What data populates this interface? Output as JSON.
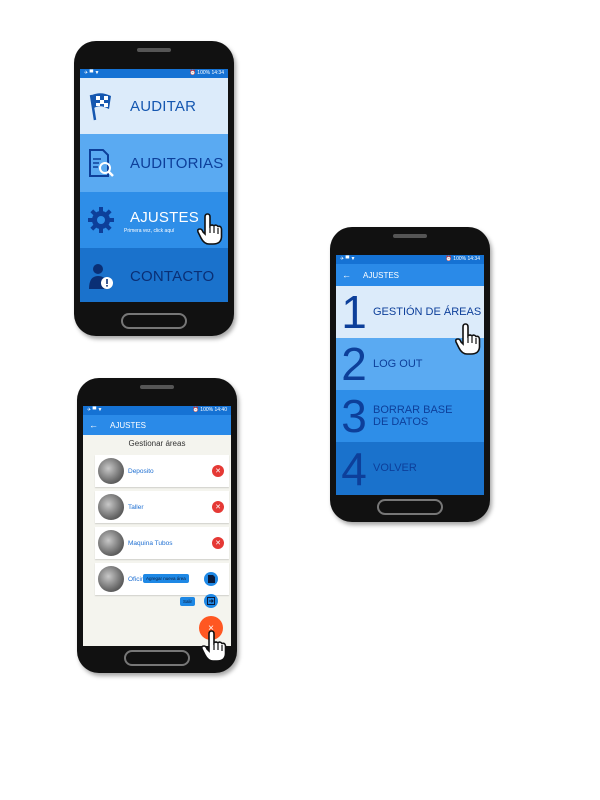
{
  "phone1": {
    "status": {
      "left": "✈ ▀ ▼",
      "right": "⏰ 100% 14:34"
    },
    "menu": [
      {
        "label": "AUDITAR",
        "icon": "checkered-flag-icon",
        "bg": "#dcebfa"
      },
      {
        "label": "AUDITORIAS",
        "icon": "document-search-icon",
        "bg": "#5aaaf2"
      },
      {
        "label": "AJUSTES",
        "icon": "gear-icon",
        "bg": "#2e8ee8",
        "sub": "Primera vez, click aquí"
      },
      {
        "label": "CONTACTO",
        "icon": "user-info-icon",
        "bg": "#1a72cc"
      }
    ]
  },
  "phone2": {
    "status": {
      "left": "✈ ▀ ▼",
      "right": "⏰ 100% 14:34"
    },
    "title": "AJUSTES",
    "items": [
      {
        "digit": "1",
        "label": "GESTIÓN DE ÁREAS",
        "bg": "#dcebfa"
      },
      {
        "digit": "2",
        "label": "LOG OUT",
        "bg": "#5aaaf2"
      },
      {
        "digit": "3",
        "label": "BORRAR BASE DE DATOS",
        "bg": "#2e8ee8"
      },
      {
        "digit": "4",
        "label": "VOLVER",
        "bg": "#1a72cc"
      }
    ]
  },
  "phone3": {
    "status": {
      "left": "✈ ▀ ▼",
      "right": "⏰ 100% 14:40"
    },
    "title": "AJUSTES",
    "section": "Gestionar áreas",
    "areas": [
      "Deposito",
      "Taller",
      "Maquina Tubos",
      "Oficin"
    ],
    "add_label": "Agregar nueva área",
    "exit_label": "Salir",
    "fab_icon": "×"
  },
  "colors": {
    "accent": "#2a8ae8",
    "danger": "#e53935",
    "fab": "#ff5722"
  }
}
